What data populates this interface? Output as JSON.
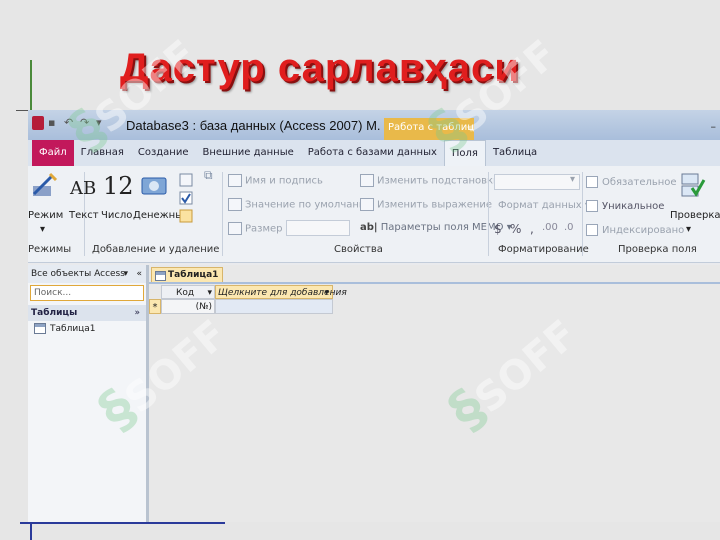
{
  "slide": {
    "title": "Дастур сарлавҳаси"
  },
  "window": {
    "db_title": "Database3 : база данных (Access 2007) M.",
    "context_tab": "Работа с таблиц..."
  },
  "ribbon_tabs": [
    {
      "label": "Файл"
    },
    {
      "label": "Главная"
    },
    {
      "label": "Создание"
    },
    {
      "label": "Внешние данные"
    },
    {
      "label": "Работа с базами данных"
    },
    {
      "label": "Поля"
    },
    {
      "label": "Таблица"
    }
  ],
  "ribbon": {
    "view": "Режим",
    "text": "Текст",
    "number": "Число",
    "currency": "Денежный",
    "text_glyph": "AB",
    "number_glyph": "12",
    "name_caption": "Имя и подпись",
    "default_value": "Значение по умолчанию",
    "field_size": "Размер поля",
    "modify_lookups": "Изменить подстановки",
    "modify_expression": "Изменить выражение",
    "memo_settings": "Параметры поля MEMO",
    "data_format": "Формат данных",
    "required": "Обязательное",
    "unique": "Уникальное",
    "indexed": "Индексировано",
    "validation": "Проверка",
    "groups": {
      "views": "Режимы",
      "add_delete": "Добавление и удаление",
      "properties": "Свойства",
      "formatting": "Форматирование",
      "validation": "Проверка поля"
    }
  },
  "nav": {
    "header": "Все объекты Access",
    "search_placeholder": "Поиск...",
    "section": "Таблицы",
    "items": [
      {
        "label": "Таблица1"
      }
    ]
  },
  "doc": {
    "tab": "Таблица1",
    "columns": [
      {
        "label": "Код"
      },
      {
        "label": "Щелкните для добавления"
      }
    ],
    "new_row_marker": "*",
    "new_row_value": "(№)"
  },
  "watermark": "SOFF",
  "colors": {
    "title": "#e01e1e",
    "file_tab": "#c2185b",
    "context": "#e9b94a"
  }
}
